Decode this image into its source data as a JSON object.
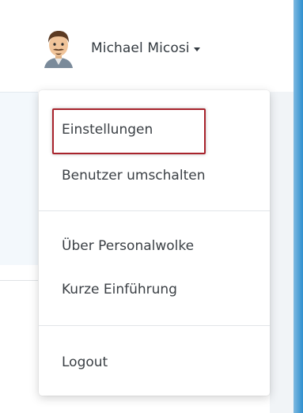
{
  "user": {
    "name": "Michael Micosi",
    "avatar_icon": "user-avatar-icon"
  },
  "menu": {
    "items": [
      {
        "label": "Einstellungen"
      },
      {
        "label": "Benutzer umschalten"
      },
      {
        "label": "Über  Personalwolke"
      },
      {
        "label": "Kurze Einführung"
      },
      {
        "label": "Logout"
      }
    ]
  },
  "colors": {
    "highlight_box": "#a8232c",
    "accent_blue": "#2e8fcf"
  }
}
